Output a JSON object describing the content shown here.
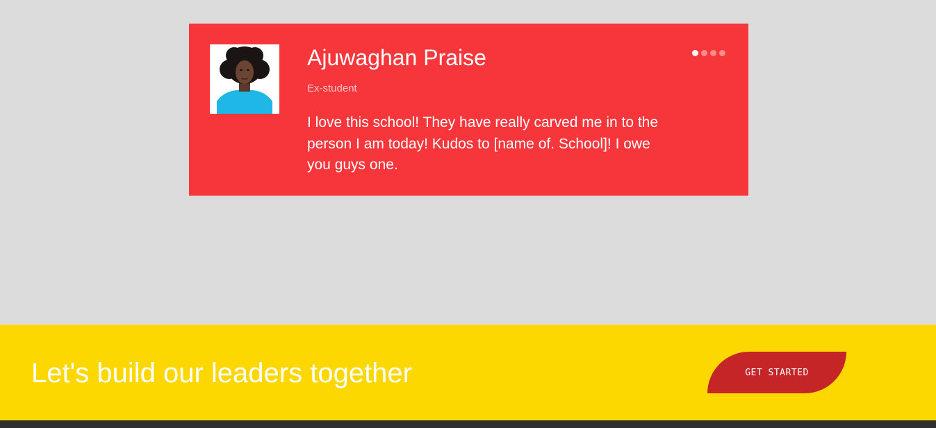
{
  "testimonial": {
    "name": "Ajuwaghan Praise",
    "role": "Ex-student",
    "quote": "I love this school! They have really carved me in to the person I am today! Kudos to [name of. School]! I owe you guys one.",
    "avatar_icon": "person-portrait",
    "carousel": {
      "total_slides": 4,
      "active_index": 0
    },
    "colors": {
      "card_background": "#f7363b",
      "dot_active": "#ffffff",
      "dot_inactive": "#fb8d8d"
    }
  },
  "cta": {
    "heading": "Let's build our leaders together",
    "button_label": "GET STARTED",
    "colors": {
      "banner_background": "#fdd700",
      "button_background": "#c62528"
    }
  },
  "colors": {
    "page_background": "#dcdcdc",
    "footer_background": "#2f2f2f"
  }
}
